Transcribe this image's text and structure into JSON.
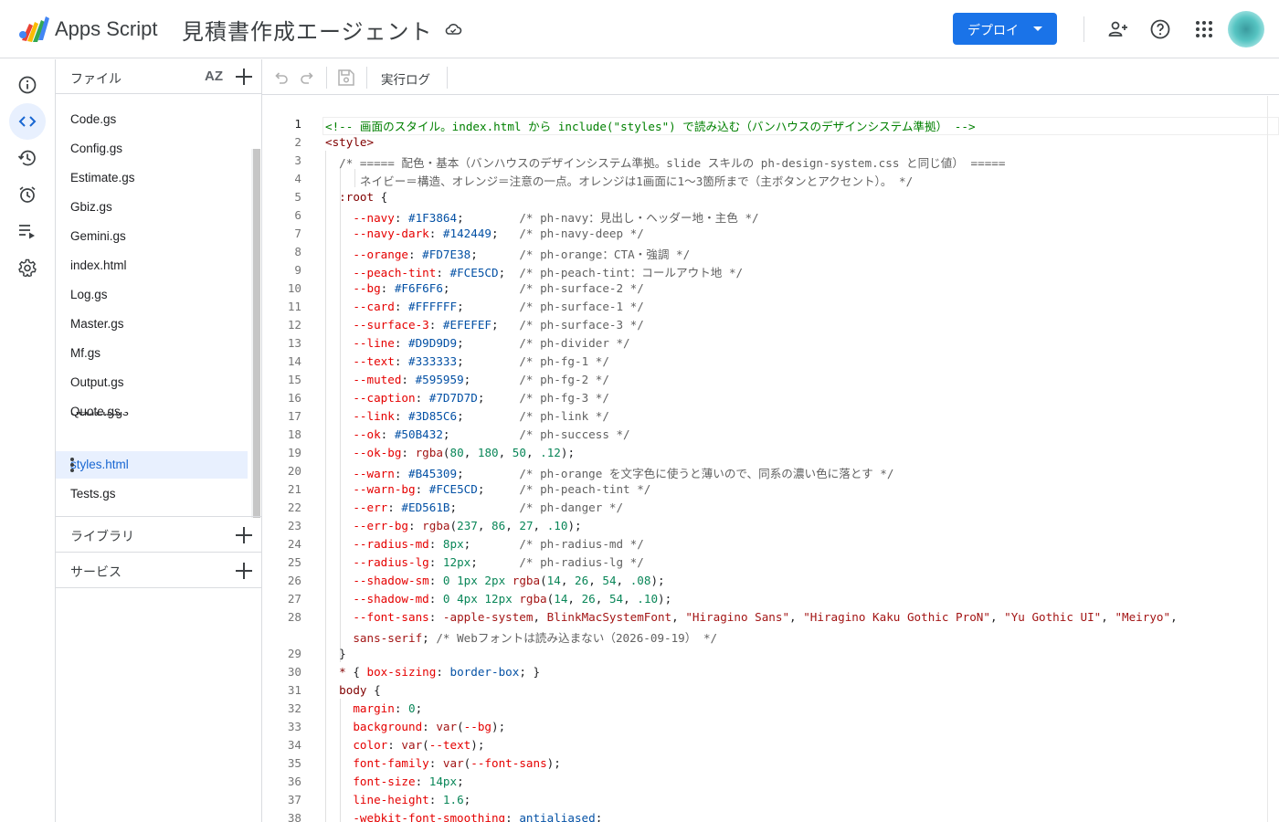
{
  "header": {
    "app_name": "Apps Script",
    "project_title": "見積書作成エージェント",
    "deploy_label": "デプロイ"
  },
  "files": {
    "title": "ファイル",
    "sort_label": "AZ",
    "items": [
      {
        "name": "Code.gs"
      },
      {
        "name": "Config.gs"
      },
      {
        "name": "Estimate.gs"
      },
      {
        "name": "Gbiz.gs"
      },
      {
        "name": "Gemini.gs"
      },
      {
        "name": "index.html"
      },
      {
        "name": "Log.gs"
      },
      {
        "name": "Master.gs"
      },
      {
        "name": "Mf.gs"
      },
      {
        "name": "Output.gs"
      },
      {
        "name": "Quote.gs"
      },
      {
        "name": "Secrets.gs"
      },
      {
        "name": "styles.html"
      },
      {
        "name": "Tests.gs"
      }
    ],
    "active": "styles.html",
    "libraries_label": "ライブラリ",
    "services_label": "サービス"
  },
  "toolbar": {
    "exec_log_label": "実行ログ"
  },
  "editor": {
    "current_line": 1,
    "lines": [
      {
        "n": "1",
        "segs": [
          [
            "c-com",
            "<!-- 画面のスタイル。index.html から include(\"styles\") で読み込む（バンハウスのデザインシステム準拠） -->"
          ]
        ]
      },
      {
        "n": "2",
        "segs": [
          [
            "c-tag",
            "<style>"
          ]
        ]
      },
      {
        "n": "3",
        "segs": [
          [
            "c-gray",
            "  /* ===== 配色・基本（バンハウスのデザインシステム準拠。slide スキルの ph-design-system.css と同じ値） ====="
          ]
        ]
      },
      {
        "n": "4",
        "segs": [
          [
            "c-gray",
            "     ネイビー＝構造、オレンジ＝注意の一点。オレンジは1画面に1〜3箇所まで（主ボタンとアクセント）。 */"
          ]
        ]
      },
      {
        "n": "5",
        "segs": [
          [
            "c-sel",
            "  :root "
          ],
          [
            "c-pun",
            "{"
          ]
        ]
      },
      {
        "n": "6",
        "segs": [
          [
            "c-prop",
            "    --navy"
          ],
          [
            "c-pun",
            ": "
          ],
          [
            "c-val",
            "#1F3864"
          ],
          [
            "c-pun",
            ";        "
          ],
          [
            "c-gray",
            "/* ph-navy：見出し・ヘッダー地・主色 */"
          ]
        ]
      },
      {
        "n": "7",
        "segs": [
          [
            "c-prop",
            "    --navy-dark"
          ],
          [
            "c-pun",
            ": "
          ],
          [
            "c-val",
            "#142449"
          ],
          [
            "c-pun",
            ";   "
          ],
          [
            "c-gray",
            "/* ph-navy-deep */"
          ]
        ]
      },
      {
        "n": "8",
        "segs": [
          [
            "c-prop",
            "    --orange"
          ],
          [
            "c-pun",
            ": "
          ],
          [
            "c-val",
            "#FD7E38"
          ],
          [
            "c-pun",
            ";      "
          ],
          [
            "c-gray",
            "/* ph-orange：CTA・強調 */"
          ]
        ]
      },
      {
        "n": "9",
        "segs": [
          [
            "c-prop",
            "    --peach-tint"
          ],
          [
            "c-pun",
            ": "
          ],
          [
            "c-val",
            "#FCE5CD"
          ],
          [
            "c-pun",
            ";  "
          ],
          [
            "c-gray",
            "/* ph-peach-tint：コールアウト地 */"
          ]
        ]
      },
      {
        "n": "10",
        "segs": [
          [
            "c-prop",
            "    --bg"
          ],
          [
            "c-pun",
            ": "
          ],
          [
            "c-val",
            "#F6F6F6"
          ],
          [
            "c-pun",
            ";          "
          ],
          [
            "c-gray",
            "/* ph-surface-2 */"
          ]
        ]
      },
      {
        "n": "11",
        "segs": [
          [
            "c-prop",
            "    --card"
          ],
          [
            "c-pun",
            ": "
          ],
          [
            "c-val",
            "#FFFFFF"
          ],
          [
            "c-pun",
            ";        "
          ],
          [
            "c-gray",
            "/* ph-surface-1 */"
          ]
        ]
      },
      {
        "n": "12",
        "segs": [
          [
            "c-prop",
            "    --surface-3"
          ],
          [
            "c-pun",
            ": "
          ],
          [
            "c-val",
            "#EFEFEF"
          ],
          [
            "c-pun",
            ";   "
          ],
          [
            "c-gray",
            "/* ph-surface-3 */"
          ]
        ]
      },
      {
        "n": "13",
        "segs": [
          [
            "c-prop",
            "    --line"
          ],
          [
            "c-pun",
            ": "
          ],
          [
            "c-val",
            "#D9D9D9"
          ],
          [
            "c-pun",
            ";        "
          ],
          [
            "c-gray",
            "/* ph-divider */"
          ]
        ]
      },
      {
        "n": "14",
        "segs": [
          [
            "c-prop",
            "    --text"
          ],
          [
            "c-pun",
            ": "
          ],
          [
            "c-val",
            "#333333"
          ],
          [
            "c-pun",
            ";        "
          ],
          [
            "c-gray",
            "/* ph-fg-1 */"
          ]
        ]
      },
      {
        "n": "15",
        "segs": [
          [
            "c-prop",
            "    --muted"
          ],
          [
            "c-pun",
            ": "
          ],
          [
            "c-val",
            "#595959"
          ],
          [
            "c-pun",
            ";       "
          ],
          [
            "c-gray",
            "/* ph-fg-2 */"
          ]
        ]
      },
      {
        "n": "16",
        "segs": [
          [
            "c-prop",
            "    --caption"
          ],
          [
            "c-pun",
            ": "
          ],
          [
            "c-val",
            "#7D7D7D"
          ],
          [
            "c-pun",
            ";     "
          ],
          [
            "c-gray",
            "/* ph-fg-3 */"
          ]
        ]
      },
      {
        "n": "17",
        "segs": [
          [
            "c-prop",
            "    --link"
          ],
          [
            "c-pun",
            ": "
          ],
          [
            "c-val",
            "#3D85C6"
          ],
          [
            "c-pun",
            ";        "
          ],
          [
            "c-gray",
            "/* ph-link */"
          ]
        ]
      },
      {
        "n": "18",
        "segs": [
          [
            "c-prop",
            "    --ok"
          ],
          [
            "c-pun",
            ": "
          ],
          [
            "c-val",
            "#50B432"
          ],
          [
            "c-pun",
            ";          "
          ],
          [
            "c-gray",
            "/* ph-success */"
          ]
        ]
      },
      {
        "n": "19",
        "segs": [
          [
            "c-prop",
            "    --ok-bg"
          ],
          [
            "c-pun",
            ": "
          ],
          [
            "c-str",
            "rgba"
          ],
          [
            "c-pun",
            "("
          ],
          [
            "c-num",
            "80"
          ],
          [
            "c-pun",
            ", "
          ],
          [
            "c-num",
            "180"
          ],
          [
            "c-pun",
            ", "
          ],
          [
            "c-num",
            "50"
          ],
          [
            "c-pun",
            ", "
          ],
          [
            "c-num",
            ".12"
          ],
          [
            "c-pun",
            ");"
          ]
        ]
      },
      {
        "n": "20",
        "segs": [
          [
            "c-prop",
            "    --warn"
          ],
          [
            "c-pun",
            ": "
          ],
          [
            "c-val",
            "#B45309"
          ],
          [
            "c-pun",
            ";        "
          ],
          [
            "c-gray",
            "/* ph-orange を文字色に使うと薄いので、同系の濃い色に落とす */"
          ]
        ]
      },
      {
        "n": "21",
        "segs": [
          [
            "c-prop",
            "    --warn-bg"
          ],
          [
            "c-pun",
            ": "
          ],
          [
            "c-val",
            "#FCE5CD"
          ],
          [
            "c-pun",
            ";     "
          ],
          [
            "c-gray",
            "/* ph-peach-tint */"
          ]
        ]
      },
      {
        "n": "22",
        "segs": [
          [
            "c-prop",
            "    --err"
          ],
          [
            "c-pun",
            ": "
          ],
          [
            "c-val",
            "#ED561B"
          ],
          [
            "c-pun",
            ";         "
          ],
          [
            "c-gray",
            "/* ph-danger */"
          ]
        ]
      },
      {
        "n": "23",
        "segs": [
          [
            "c-prop",
            "    --err-bg"
          ],
          [
            "c-pun",
            ": "
          ],
          [
            "c-str",
            "rgba"
          ],
          [
            "c-pun",
            "("
          ],
          [
            "c-num",
            "237"
          ],
          [
            "c-pun",
            ", "
          ],
          [
            "c-num",
            "86"
          ],
          [
            "c-pun",
            ", "
          ],
          [
            "c-num",
            "27"
          ],
          [
            "c-pun",
            ", "
          ],
          [
            "c-num",
            ".10"
          ],
          [
            "c-pun",
            ");"
          ]
        ]
      },
      {
        "n": "24",
        "segs": [
          [
            "c-prop",
            "    --radius-md"
          ],
          [
            "c-pun",
            ": "
          ],
          [
            "c-num",
            "8px"
          ],
          [
            "c-pun",
            ";       "
          ],
          [
            "c-gray",
            "/* ph-radius-md */"
          ]
        ]
      },
      {
        "n": "25",
        "segs": [
          [
            "c-prop",
            "    --radius-lg"
          ],
          [
            "c-pun",
            ": "
          ],
          [
            "c-num",
            "12px"
          ],
          [
            "c-pun",
            ";      "
          ],
          [
            "c-gray",
            "/* ph-radius-lg */"
          ]
        ]
      },
      {
        "n": "26",
        "segs": [
          [
            "c-prop",
            "    --shadow-sm"
          ],
          [
            "c-pun",
            ": "
          ],
          [
            "c-num",
            "0 1px 2px "
          ],
          [
            "c-str",
            "rgba"
          ],
          [
            "c-pun",
            "("
          ],
          [
            "c-num",
            "14"
          ],
          [
            "c-pun",
            ", "
          ],
          [
            "c-num",
            "26"
          ],
          [
            "c-pun",
            ", "
          ],
          [
            "c-num",
            "54"
          ],
          [
            "c-pun",
            ", "
          ],
          [
            "c-num",
            ".08"
          ],
          [
            "c-pun",
            ");"
          ]
        ]
      },
      {
        "n": "27",
        "segs": [
          [
            "c-prop",
            "    --shadow-md"
          ],
          [
            "c-pun",
            ": "
          ],
          [
            "c-num",
            "0 4px 12px "
          ],
          [
            "c-str",
            "rgba"
          ],
          [
            "c-pun",
            "("
          ],
          [
            "c-num",
            "14"
          ],
          [
            "c-pun",
            ", "
          ],
          [
            "c-num",
            "26"
          ],
          [
            "c-pun",
            ", "
          ],
          [
            "c-num",
            "54"
          ],
          [
            "c-pun",
            ", "
          ],
          [
            "c-num",
            ".10"
          ],
          [
            "c-pun",
            ");"
          ]
        ]
      },
      {
        "n": "28",
        "segs": [
          [
            "c-prop",
            "    --font-sans"
          ],
          [
            "c-pun",
            ": "
          ],
          [
            "c-str",
            "-apple-system"
          ],
          [
            "c-pun",
            ", "
          ],
          [
            "c-str",
            "BlinkMacSystemFont"
          ],
          [
            "c-pun",
            ", "
          ],
          [
            "c-str",
            "\"Hiragino Sans\""
          ],
          [
            "c-pun",
            ", "
          ],
          [
            "c-str",
            "\"Hiragino Kaku Gothic ProN\""
          ],
          [
            "c-pun",
            ", "
          ],
          [
            "c-str",
            "\"Yu Gothic UI\""
          ],
          [
            "c-pun",
            ", "
          ],
          [
            "c-str",
            "\"Meiryo\""
          ],
          [
            "c-pun",
            ","
          ]
        ]
      },
      {
        "n": "",
        "segs": [
          [
            "c-str",
            "    sans-serif"
          ],
          [
            "c-pun",
            "; "
          ],
          [
            "c-gray",
            "/* Webフォントは読み込まない（2026-09-19） */"
          ]
        ]
      },
      {
        "n": "29",
        "segs": [
          [
            "c-pun",
            "  }"
          ]
        ]
      },
      {
        "n": "30",
        "segs": [
          [
            "c-sel",
            "  * "
          ],
          [
            "c-pun",
            "{ "
          ],
          [
            "c-prop",
            "box-sizing"
          ],
          [
            "c-pun",
            ": "
          ],
          [
            "c-val",
            "border-box"
          ],
          [
            "c-pun",
            "; }"
          ]
        ]
      },
      {
        "n": "31",
        "segs": [
          [
            "c-sel",
            "  body "
          ],
          [
            "c-pun",
            "{"
          ]
        ]
      },
      {
        "n": "32",
        "segs": [
          [
            "c-prop",
            "    margin"
          ],
          [
            "c-pun",
            ": "
          ],
          [
            "c-num",
            "0"
          ],
          [
            "c-pun",
            ";"
          ]
        ]
      },
      {
        "n": "33",
        "segs": [
          [
            "c-prop",
            "    background"
          ],
          [
            "c-pun",
            ": "
          ],
          [
            "c-str",
            "var"
          ],
          [
            "c-pun",
            "("
          ],
          [
            "c-prop",
            "--bg"
          ],
          [
            "c-pun",
            ");"
          ]
        ]
      },
      {
        "n": "34",
        "segs": [
          [
            "c-prop",
            "    color"
          ],
          [
            "c-pun",
            ": "
          ],
          [
            "c-str",
            "var"
          ],
          [
            "c-pun",
            "("
          ],
          [
            "c-prop",
            "--text"
          ],
          [
            "c-pun",
            ");"
          ]
        ]
      },
      {
        "n": "35",
        "segs": [
          [
            "c-prop",
            "    font-family"
          ],
          [
            "c-pun",
            ": "
          ],
          [
            "c-str",
            "var"
          ],
          [
            "c-pun",
            "("
          ],
          [
            "c-prop",
            "--font-sans"
          ],
          [
            "c-pun",
            ");"
          ]
        ]
      },
      {
        "n": "36",
        "segs": [
          [
            "c-prop",
            "    font-size"
          ],
          [
            "c-pun",
            ": "
          ],
          [
            "c-num",
            "14px"
          ],
          [
            "c-pun",
            ";"
          ]
        ]
      },
      {
        "n": "37",
        "segs": [
          [
            "c-prop",
            "    line-height"
          ],
          [
            "c-pun",
            ": "
          ],
          [
            "c-num",
            "1.6"
          ],
          [
            "c-pun",
            ";"
          ]
        ]
      },
      {
        "n": "38",
        "segs": [
          [
            "c-prop",
            "    -webkit-font-smoothing"
          ],
          [
            "c-pun",
            ": "
          ],
          [
            "c-val",
            "antialiased"
          ],
          [
            "c-pun",
            ";"
          ]
        ]
      }
    ]
  },
  "icons": {
    "rail": [
      "info-icon",
      "code-icon",
      "history-icon",
      "alarm-icon",
      "executions-icon",
      "settings-icon"
    ],
    "header": [
      "cloud-icon",
      "add-person-icon",
      "help-icon",
      "apps-grid-icon"
    ]
  },
  "colors": {
    "accent": "#1a73e8",
    "active_file_bg": "#e8f0fe",
    "active_file_text": "#1967d2"
  }
}
